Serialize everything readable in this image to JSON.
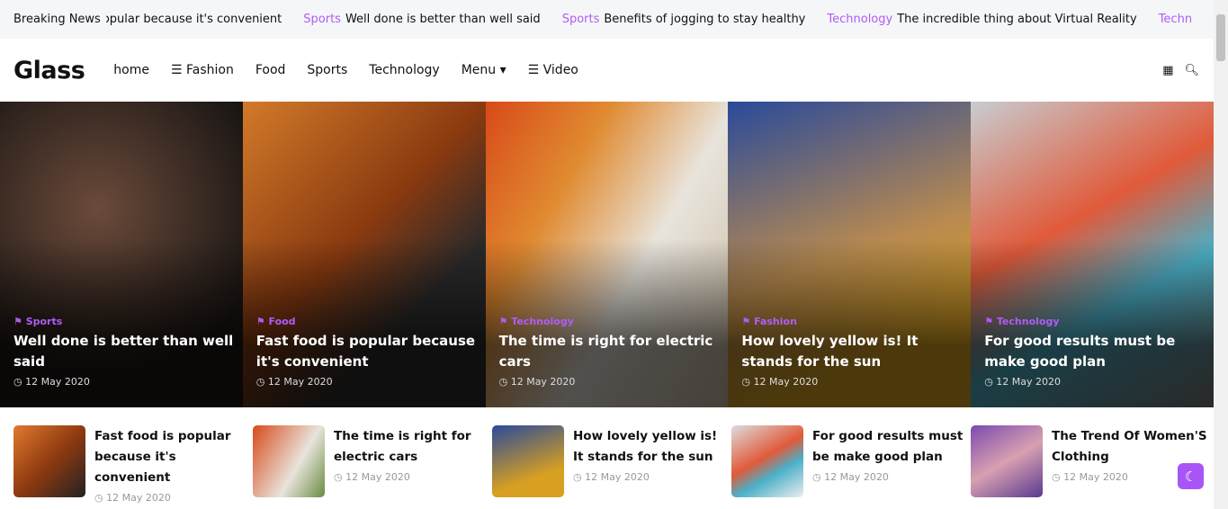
{
  "ticker": {
    "label": "Breaking News",
    "items": [
      {
        "category": "",
        "title": "opular because it's convenient"
      },
      {
        "category": "Sports",
        "title": "Well done is better than well said"
      },
      {
        "category": "Sports",
        "title": "Benefits of jogging to stay healthy"
      },
      {
        "category": "Technology",
        "title": "The incredible thing about Virtual Reality"
      },
      {
        "category": "Techn",
        "title": ""
      }
    ]
  },
  "header": {
    "logo": "Glass",
    "nav": [
      "home",
      "☰ Fashion",
      "Food",
      "Sports",
      "Technology",
      "Menu ▾",
      "☰ Video"
    ]
  },
  "hero": [
    {
      "category": "Sports",
      "title": "Well done is better than well said",
      "date": "12 May 2020",
      "bg": "radial-gradient(circle at 40% 35%,#6b4a3a,#1a1614 70%)"
    },
    {
      "category": "Food",
      "title": "Fast food is popular because it's convenient",
      "date": "12 May 2020",
      "bg": "linear-gradient(135deg,#d27a2a,#8a3a10 45%,#2a2a2a 70%)"
    },
    {
      "category": "Technology",
      "title": "The time is right for electric cars",
      "date": "12 May 2020",
      "bg": "linear-gradient(120deg,#d84a1a,#e08a30 30%,#e8e4dc 60%,#c8b8a0)"
    },
    {
      "category": "Fashion",
      "title": "How lovely yellow is! It stands for the sun",
      "date": "12 May 2020",
      "bg": "linear-gradient(160deg,#2a4a9a,#b88a50 50%,#d8a020 80%)"
    },
    {
      "category": "Technology",
      "title": "For good results must be make good plan",
      "date": "12 May 2020",
      "bg": "linear-gradient(150deg,#c8ccd0,#e05a3a 40%,#4ab0c8 65%,#777)"
    }
  ],
  "list": [
    {
      "title": "Fast food is popular because it's convenient",
      "date": "12 May 2020",
      "bg": "linear-gradient(135deg,#e07a30,#903a10 50%,#222)"
    },
    {
      "title": "The time is right for electric cars",
      "date": "12 May 2020",
      "bg": "linear-gradient(120deg,#d84a1a,#e8e4dc 60%,#6a8a40)"
    },
    {
      "title": "How lovely yellow is! It stands for the sun",
      "date": "12 May 2020",
      "bg": "linear-gradient(160deg,#2a4a9a,#d8a020 70%)"
    },
    {
      "title": "For good results must be make good plan",
      "date": "12 May 2020",
      "bg": "linear-gradient(150deg,#ddd,#e05a3a 45%,#4ab0c8 65%,#eee)"
    },
    {
      "title": "The Trend Of Women'S Clothing",
      "date": "12 May 2020",
      "bg": "linear-gradient(150deg,#7a4ab0,#d8a0b0 50%,#5a3a90)"
    }
  ],
  "accent": "#b05cf5"
}
